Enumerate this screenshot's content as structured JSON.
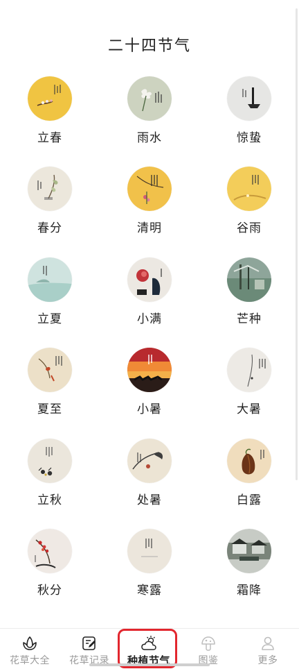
{
  "header": {
    "title": "二十四节气"
  },
  "terms": [
    {
      "label": "立春",
      "icon": "lichun-painting-icon",
      "bg": "#f0c442"
    },
    {
      "label": "雨水",
      "icon": "yushui-painting-icon",
      "bg": "#cdd3c0"
    },
    {
      "label": "惊蛰",
      "icon": "jingzhe-painting-icon",
      "bg": "#e6e6e4"
    },
    {
      "label": "春分",
      "icon": "chunfen-painting-icon",
      "bg": "#ece7dc"
    },
    {
      "label": "清明",
      "icon": "qingming-painting-icon",
      "bg": "#f1c14a"
    },
    {
      "label": "谷雨",
      "icon": "guyu-painting-icon",
      "bg": "#f3cd5a"
    },
    {
      "label": "立夏",
      "icon": "lixia-painting-icon",
      "bg": "#cfe3df"
    },
    {
      "label": "小满",
      "icon": "xiaoman-painting-icon",
      "bg": "#ece8e2"
    },
    {
      "label": "芒种",
      "icon": "mangzhong-painting-icon",
      "bg": "#8ea59a"
    },
    {
      "label": "夏至",
      "icon": "xiazhi-painting-icon",
      "bg": "#ece0c8"
    },
    {
      "label": "小暑",
      "icon": "xiaoshu-painting-icon",
      "bg": "#e8572e"
    },
    {
      "label": "大暑",
      "icon": "dashu-painting-icon",
      "bg": "#edeae5"
    },
    {
      "label": "立秋",
      "icon": "liqiu-painting-icon",
      "bg": "#ebe6dc"
    },
    {
      "label": "处暑",
      "icon": "chushu-painting-icon",
      "bg": "#ece4d4"
    },
    {
      "label": "白露",
      "icon": "bailu-painting-icon",
      "bg": "#f0ddbd"
    },
    {
      "label": "秋分",
      "icon": "qiufen-painting-icon",
      "bg": "#efe9e4"
    },
    {
      "label": "寒露",
      "icon": "hanlu-painting-icon",
      "bg": "#ece6dc"
    },
    {
      "label": "霜降",
      "icon": "shuangjiang-painting-icon",
      "bg": "#c7cbc5"
    }
  ],
  "nav": {
    "items": [
      {
        "label": "花草大全",
        "icon": "flower-icon"
      },
      {
        "label": "花草记录",
        "icon": "note-edit-icon"
      },
      {
        "label": "种植节气",
        "icon": "weather-cloud-icon",
        "active": true
      },
      {
        "label": "图鉴",
        "icon": "mushroom-icon"
      },
      {
        "label": "更多",
        "icon": "user-icon"
      }
    ],
    "highlight_color": "#e2262e"
  }
}
